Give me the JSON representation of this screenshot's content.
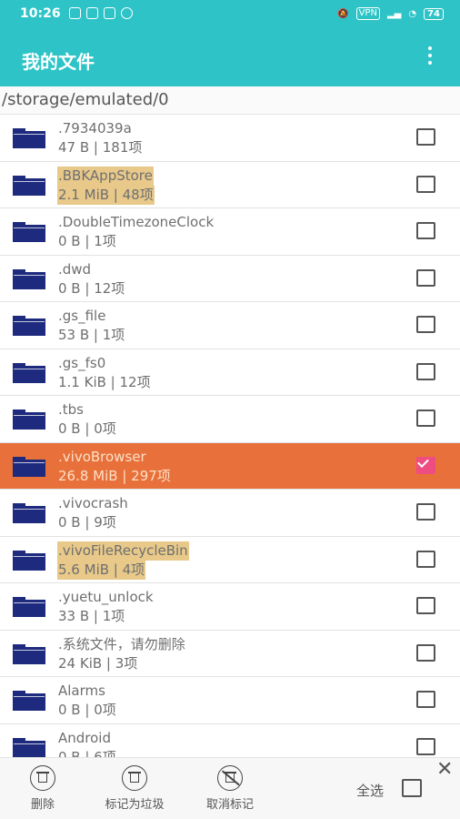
{
  "status_bar": {
    "time": "10:26",
    "left_icons": [
      "sim-icon",
      "notification-icon",
      "grid-icon",
      "refresh-icon"
    ],
    "right_icons": [
      "mute-icon",
      "vpn-icon",
      "signal-icon",
      "wifi-icon",
      "battery-icon"
    ],
    "vpn_label": "VPN",
    "battery": "74"
  },
  "app_bar": {
    "title": "我的文件",
    "more_icon": "more-vert-icon"
  },
  "path": "/storage/emulated/0",
  "accent": {
    "bar": "#2ec4c7",
    "selected_row": "#e8703a",
    "highlight": "#e8c98a",
    "checked": "#ee4d82",
    "folder": "#1d2a7e"
  },
  "files": [
    {
      "name": ".7934039a",
      "meta": "47 B | 181项",
      "checked": false,
      "highlight": false
    },
    {
      "name": ".BBKAppStore",
      "meta": "2.1 MiB | 48项",
      "checked": false,
      "highlight": true
    },
    {
      "name": ".DoubleTimezoneClock",
      "meta": "0 B | 1项",
      "checked": false,
      "highlight": false
    },
    {
      "name": ".dwd",
      "meta": "0 B | 12项",
      "checked": false,
      "highlight": false
    },
    {
      "name": ".gs_file",
      "meta": "53 B | 1项",
      "checked": false,
      "highlight": false
    },
    {
      "name": ".gs_fs0",
      "meta": "1.1 KiB | 12项",
      "checked": false,
      "highlight": false
    },
    {
      "name": ".tbs",
      "meta": "0 B | 0项",
      "checked": false,
      "highlight": false
    },
    {
      "name": ".vivoBrowser",
      "meta": "26.8 MiB | 297项",
      "checked": true,
      "highlight": false
    },
    {
      "name": ".vivocrash",
      "meta": "0 B | 9项",
      "checked": false,
      "highlight": false
    },
    {
      "name": ".vivoFileRecycleBin",
      "meta": "5.6 MiB | 4项",
      "checked": false,
      "highlight": true
    },
    {
      "name": ".yuetu_unlock",
      "meta": "33 B | 1项",
      "checked": false,
      "highlight": false
    },
    {
      "name": ".系统文件，请勿删除",
      "meta": "24 KiB | 3项",
      "checked": false,
      "highlight": false
    },
    {
      "name": "Alarms",
      "meta": "0 B | 0项",
      "checked": false,
      "highlight": false
    },
    {
      "name": "Android",
      "meta": "0 B | 6项",
      "checked": false,
      "highlight": false
    }
  ],
  "bottom_bar": {
    "delete_label": "删除",
    "mark_trash_label": "标记为垃圾",
    "unmark_label": "取消标记",
    "select_all_label": "全选",
    "close_symbol": "✕"
  }
}
